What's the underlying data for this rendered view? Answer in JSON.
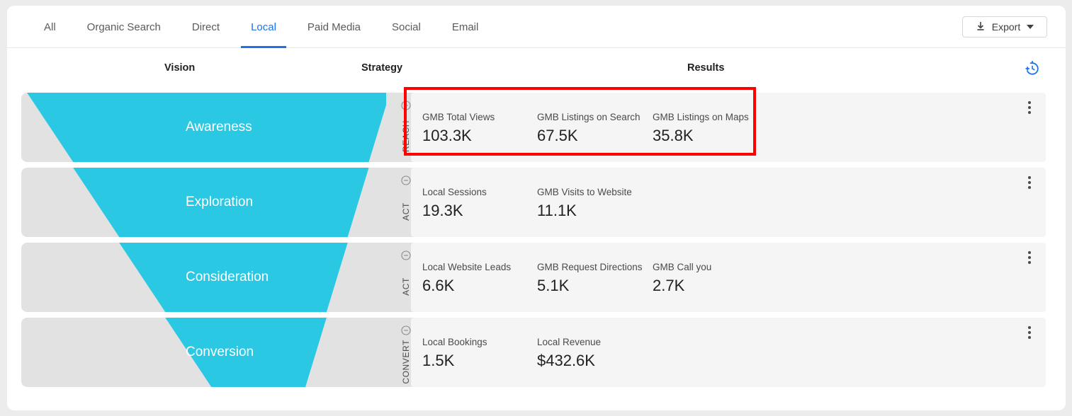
{
  "tabs": [
    {
      "label": "All",
      "active": false
    },
    {
      "label": "Organic Search",
      "active": false
    },
    {
      "label": "Direct",
      "active": false
    },
    {
      "label": "Local",
      "active": true
    },
    {
      "label": "Paid Media",
      "active": false
    },
    {
      "label": "Social",
      "active": false
    },
    {
      "label": "Email",
      "active": false
    }
  ],
  "toolbar": {
    "export_label": "Export",
    "export_icon": "download-icon",
    "export_caret_icon": "chevron-down-icon",
    "history_icon": "history-clock-icon"
  },
  "columns": {
    "vision": "Vision",
    "strategy": "Strategy",
    "results": "Results"
  },
  "colors": {
    "funnel": "#2BC8E4",
    "funnel_track": "#E2E2E2",
    "results_bg": "#F5F5F5",
    "accent": "#1A73E8",
    "annotation": "#FF0000"
  },
  "annotation": {
    "present": true,
    "target": "awareness-results-metrics"
  },
  "rows": [
    {
      "vision": "Awareness",
      "strategy": "REACH",
      "collapse_icon": "minus-circle-icon",
      "menu_icon": "more-vertical-icon",
      "metrics": [
        {
          "label": "GMB Total Views",
          "value": "103.3K"
        },
        {
          "label": "GMB Listings on Search",
          "value": "67.5K"
        },
        {
          "label": "GMB Listings on Maps",
          "value": "35.8K"
        }
      ]
    },
    {
      "vision": "Exploration",
      "strategy": "ACT",
      "collapse_icon": "minus-circle-icon",
      "menu_icon": "more-vertical-icon",
      "metrics": [
        {
          "label": "Local Sessions",
          "value": "19.3K"
        },
        {
          "label": "GMB Visits to Website",
          "value": "11.1K"
        }
      ]
    },
    {
      "vision": "Consideration",
      "strategy": "ACT",
      "collapse_icon": "minus-circle-icon",
      "menu_icon": "more-vertical-icon",
      "metrics": [
        {
          "label": "Local Website Leads",
          "value": "6.6K"
        },
        {
          "label": "GMB Request Directions",
          "value": "5.1K"
        },
        {
          "label": "GMB Call you",
          "value": "2.7K"
        }
      ]
    },
    {
      "vision": "Conversion",
      "strategy": "CONVERT",
      "collapse_icon": "minus-circle-icon",
      "menu_icon": "more-vertical-icon",
      "metrics": [
        {
          "label": "Local Bookings",
          "value": "1.5K"
        },
        {
          "label": "Local Revenue",
          "value": "$432.6K"
        }
      ]
    }
  ]
}
